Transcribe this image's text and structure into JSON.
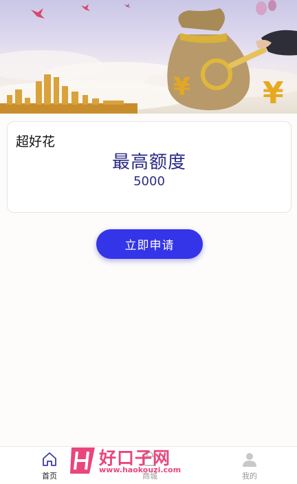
{
  "banner": {
    "image_description_icons": [
      "money-bag-icon",
      "key-icon",
      "yuan-icon",
      "city-skyline",
      "balloon-icon"
    ]
  },
  "card": {
    "product_name": "超好花",
    "limit_title": "最高额度",
    "limit_amount": "5000"
  },
  "apply_button": {
    "label": "立即申请"
  },
  "tabbar": {
    "items": [
      {
        "label": "首页",
        "icon": "home-icon",
        "active": true
      },
      {
        "label": "商城",
        "icon": "shop-icon",
        "active": false
      },
      {
        "label": "我的",
        "icon": "user-icon",
        "active": false
      }
    ]
  },
  "watermark": {
    "text": "好口子网",
    "url": "www.haokouzi.com"
  },
  "colors": {
    "accent": "#3434e8",
    "limit_text": "#2a2a86",
    "watermark": "#e9467d"
  }
}
